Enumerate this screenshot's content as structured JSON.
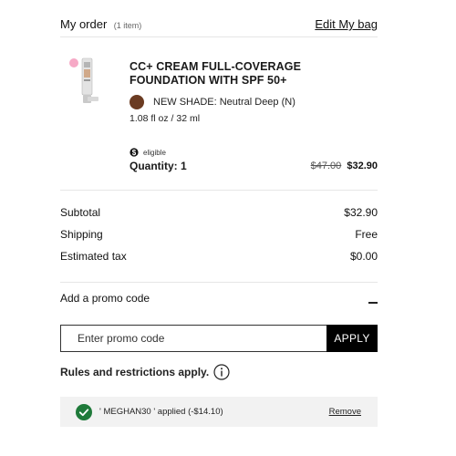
{
  "header": {
    "title": "My order",
    "item_count": "(1 item)",
    "edit_link": "Edit My bag"
  },
  "product": {
    "name": "CC+ CREAM FULL-COVERAGE FOUNDATION WITH SPF 50+",
    "shade_label": "NEW SHADE: Neutral Deep (N)",
    "shade_color": "#6b3b22",
    "size": "1.08 fl oz / 32 ml",
    "eligible_icon": "dollar-icon",
    "eligible_label": "eligible",
    "quantity_label": "Quantity: 1",
    "price_original": "$47.00",
    "price_current": "$32.90"
  },
  "summary": {
    "subtotal_label": "Subtotal",
    "subtotal_value": "$32.90",
    "shipping_label": "Shipping",
    "shipping_value": "Free",
    "tax_label": "Estimated tax",
    "tax_value": "$0.00"
  },
  "promo": {
    "toggle_label": "Add a promo code",
    "input_placeholder": "Enter promo code",
    "input_value": "",
    "apply_label": "APPLY",
    "rules_label": "Rules and restrictions apply.",
    "applied_text": "' MEGHAN30 ' applied (-$14.10)",
    "remove_label": "Remove"
  },
  "colors": {
    "accent_green": "#1f7a3a",
    "button_bg": "#000000",
    "applied_bg": "#f2f2f2"
  }
}
